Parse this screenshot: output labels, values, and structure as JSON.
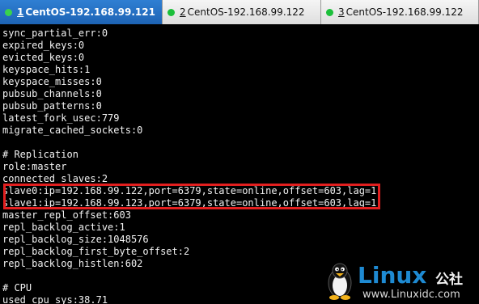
{
  "tabs": [
    {
      "num": "1",
      "label": "CentOS-192.168.99.121",
      "active": true
    },
    {
      "num": "2",
      "label": "CentOS-192.168.99.122",
      "active": false
    },
    {
      "num": "3",
      "label": "CentOS-192.168.99.122",
      "active": false
    }
  ],
  "terminal": {
    "lines": [
      "sync_partial_err:0",
      "expired_keys:0",
      "evicted_keys:0",
      "keyspace_hits:1",
      "keyspace_misses:0",
      "pubsub_channels:0",
      "pubsub_patterns:0",
      "latest_fork_usec:779",
      "migrate_cached_sockets:0",
      "",
      "# Replication",
      "role:master",
      "connected_slaves:2",
      "slave0:ip=192.168.99.122,port=6379,state=online,offset=603,lag=1",
      "slave1:ip=192.168.99.123,port=6379,state=online,offset=603,lag=1",
      "master_repl_offset:603",
      "repl_backlog_active:1",
      "repl_backlog_size:1048576",
      "repl_backlog_first_byte_offset:2",
      "repl_backlog_histlen:602",
      "",
      "# CPU",
      "used_cpu_sys:38.71"
    ]
  },
  "watermark": {
    "brand": "Linux",
    "brand_cn": "公社",
    "url": "www.Linuxidc.com"
  },
  "colors": {
    "tab_active": "#1d63b4",
    "status_dot": "#1bbf3a",
    "highlight": "#e21f1f",
    "watermark": "#1e8ad2"
  }
}
